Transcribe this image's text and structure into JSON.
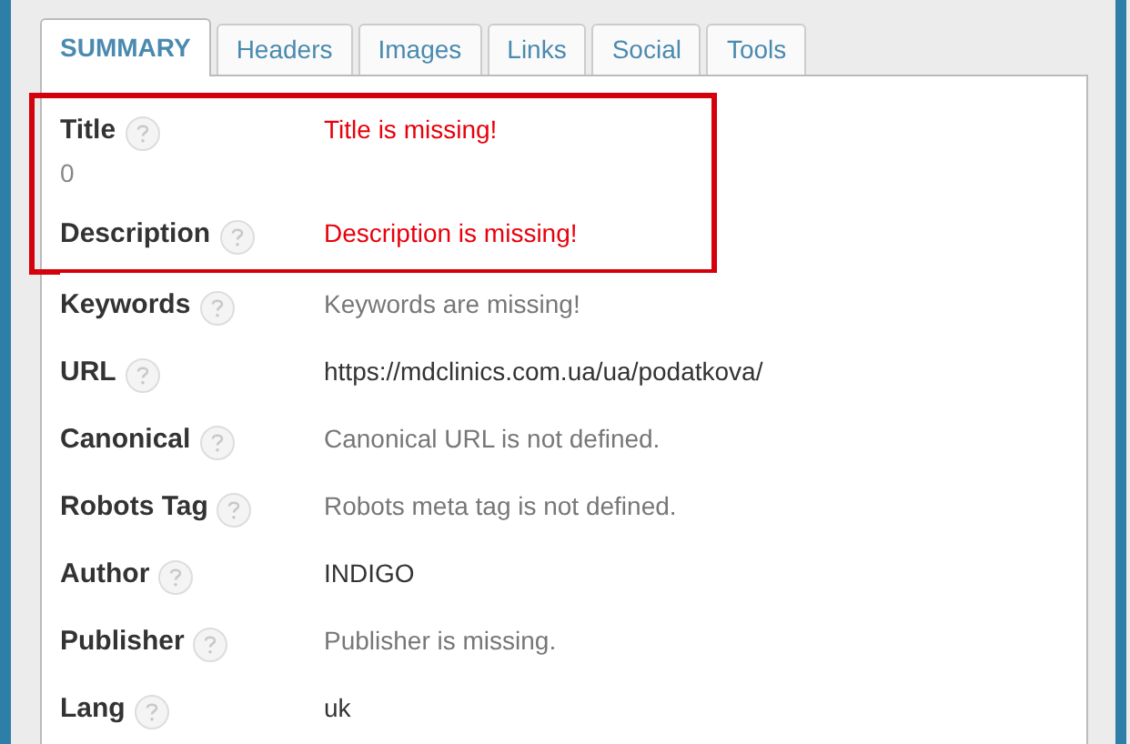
{
  "tabs": [
    {
      "label": "SUMMARY",
      "selected": true
    },
    {
      "label": "Headers",
      "selected": false
    },
    {
      "label": "Images",
      "selected": false
    },
    {
      "label": "Links",
      "selected": false
    },
    {
      "label": "Social",
      "selected": false
    },
    {
      "label": "Tools",
      "selected": false
    }
  ],
  "rows": [
    {
      "label": "Title",
      "sub": "0",
      "value": "Title is missing!",
      "kind": "error",
      "highlighted": true
    },
    {
      "label": "Description",
      "value": "Description is missing!",
      "kind": "error",
      "highlighted": true
    },
    {
      "label": "Keywords",
      "value": "Keywords are missing!",
      "kind": "missing",
      "highlighted": false
    },
    {
      "label": "URL",
      "value": "https://mdclinics.com.ua/ua/podatkova/",
      "kind": "ok",
      "highlighted": false
    },
    {
      "label": "Canonical",
      "value": "Canonical URL is not defined.",
      "kind": "missing",
      "highlighted": false
    },
    {
      "label": "Robots Tag",
      "value": "Robots meta tag is not defined.",
      "kind": "missing",
      "highlighted": false
    },
    {
      "label": "Author",
      "value": "INDIGO",
      "kind": "ok",
      "highlighted": false
    },
    {
      "label": "Publisher",
      "value": "Publisher is missing.",
      "kind": "missing",
      "highlighted": false
    },
    {
      "label": "Lang",
      "value": "uk",
      "kind": "ok",
      "highlighted": false
    }
  ]
}
